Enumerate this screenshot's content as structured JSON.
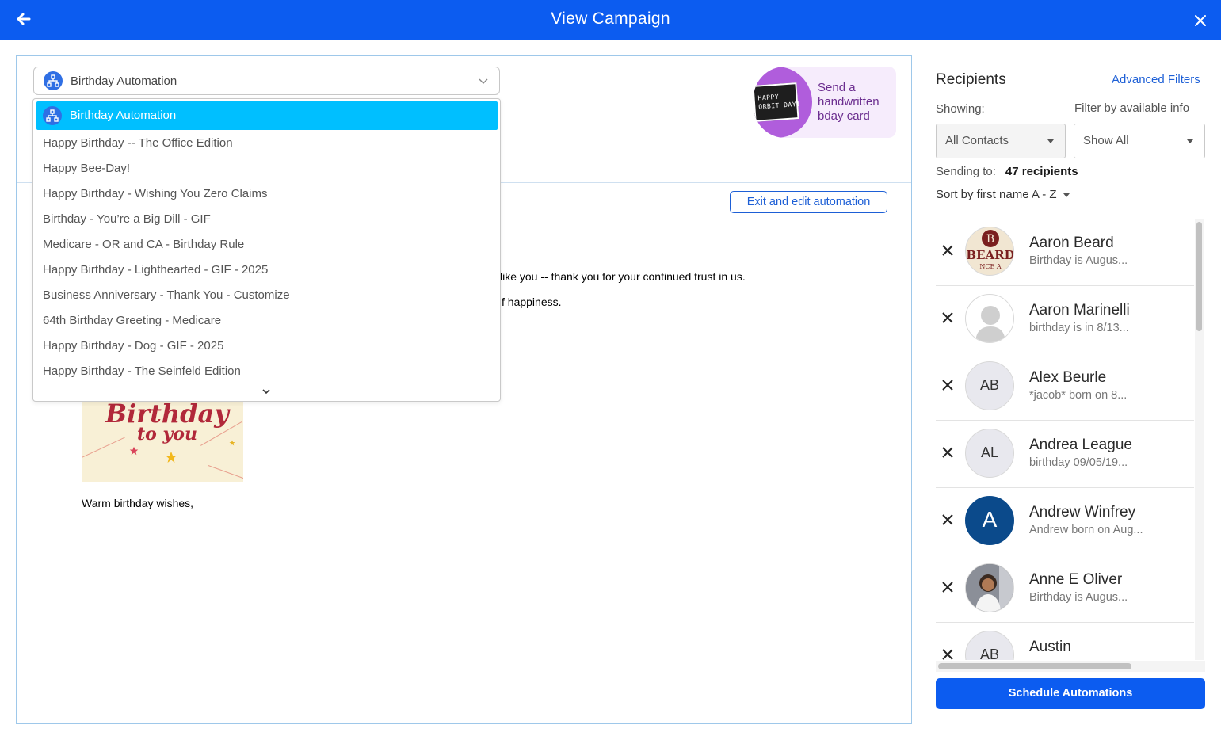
{
  "header": {
    "title": "View Campaign",
    "back_icon": "arrow-left-icon",
    "close_icon": "close-icon"
  },
  "campaign_select": {
    "selected": "Birthday Automation"
  },
  "dropdown": {
    "selected": "Birthday Automation",
    "options": [
      "Happy Birthday -- The Office Edition",
      "Happy Bee-Day!",
      "Happy Birthday - Wishing You Zero Claims",
      "Birthday - You’re a Big Dill - GIF",
      "Medicare - OR and CA - Birthday Rule",
      "Happy Birthday - Lighthearted - GIF - 2025",
      "Business Anniversary - Thank You - Customize",
      "64th Birthday Greeting - Medicare",
      "Happy Birthday - Dog - GIF - 2025",
      "Happy Birthday - The Seinfeld Edition"
    ]
  },
  "promo": {
    "card_text": "HAPPY\nORBIT DAY!",
    "text": "Send a handwritten bday card"
  },
  "editor": {
    "exit_button": "Exit and edit automation",
    "line1": "like you -- thank you for your continued trust in us.",
    "line2": "f happiness.",
    "image_text1": "Birthday",
    "image_text2": "to you",
    "closing": "Warm birthday wishes,"
  },
  "recipients": {
    "title": "Recipients",
    "advanced_filters": "Advanced Filters",
    "showing_label": "Showing:",
    "filter_label": "Filter by available info",
    "showing_value": "All Contacts",
    "filter_value": "Show All",
    "sending_label": "Sending to:",
    "sending_count": "47 recipients",
    "sort_label": "Sort by first name A - Z",
    "list": [
      {
        "name": "Aaron Beard",
        "sub": "Birthday is Augus...",
        "avatar": "logo"
      },
      {
        "name": "Aaron Marinelli",
        "sub": "birthday is in 8/13...",
        "avatar": "placeholder"
      },
      {
        "name": "Alex Beurle",
        "sub": "*jacob* born on 8...",
        "initials": "AB"
      },
      {
        "name": "Andrea League",
        "sub": "birthday 09/05/19...",
        "initials": "AL"
      },
      {
        "name": "Andrew Winfrey",
        "sub": "Andrew born on Aug...",
        "initials": "A"
      },
      {
        "name": "Anne E Oliver",
        "sub": "Birthday is Augus...",
        "avatar": "photo"
      },
      {
        "name": "Austin",
        "sub": "",
        "initials": "AB"
      }
    ]
  },
  "schedule_button": "Schedule Automations",
  "logo_text": {
    "top": "B",
    "mid": "BEARD",
    "bottom": "NCE A"
  },
  "colors": {
    "primary": "#0c5cf0",
    "dropdown_selected": "#00bfff",
    "promo_purple": "#b05ddc",
    "avatar_blue": "#0b4a8b"
  }
}
